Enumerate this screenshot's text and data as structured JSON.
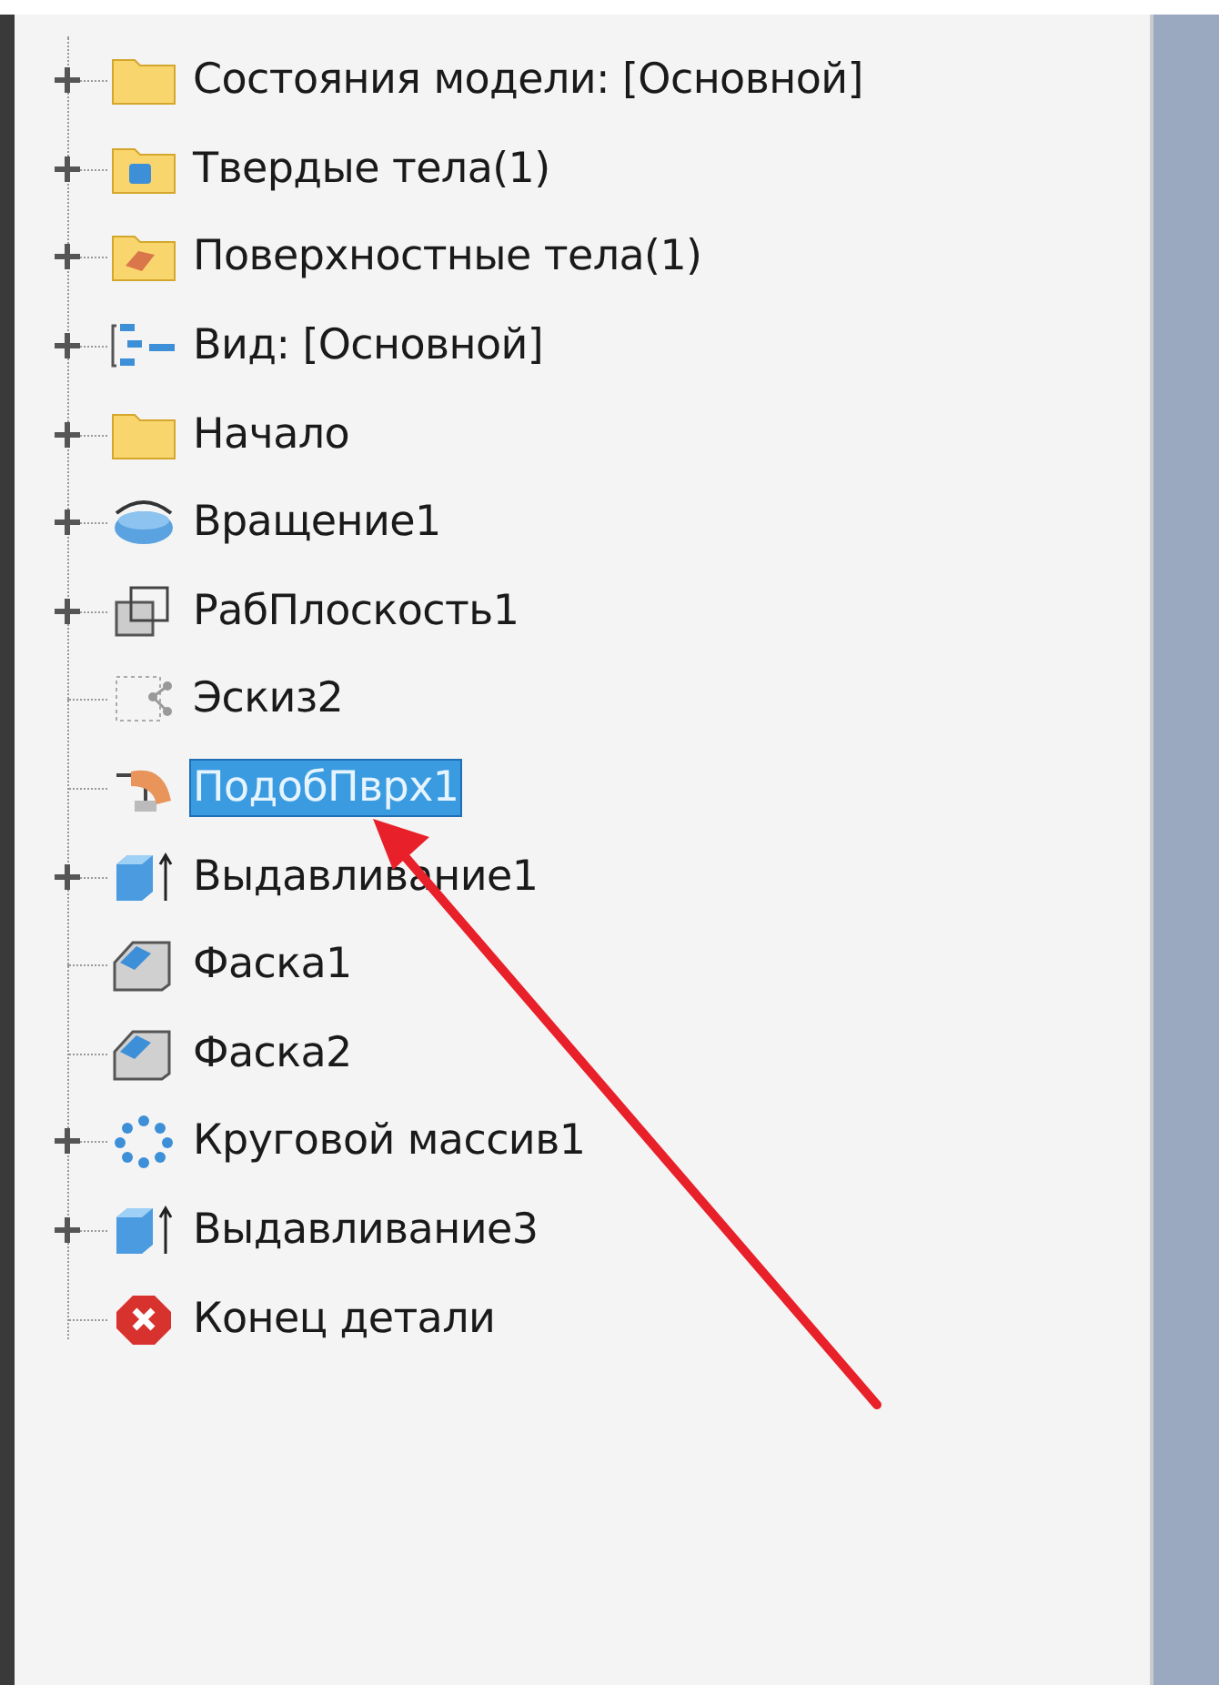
{
  "tree": {
    "items": [
      {
        "label": "Состояния модели: [Основной]",
        "kind": "folder",
        "expandable": true,
        "selected": false
      },
      {
        "label": "Твердые тела(1)",
        "kind": "solid-folder",
        "expandable": true,
        "selected": false
      },
      {
        "label": "Поверхностные тела(1)",
        "kind": "surface-folder",
        "expandable": true,
        "selected": false
      },
      {
        "label": "Вид: [Основной]",
        "kind": "view",
        "expandable": true,
        "selected": false
      },
      {
        "label": "Начало",
        "kind": "folder",
        "expandable": true,
        "selected": false
      },
      {
        "label": "Вращение1",
        "kind": "revolve",
        "expandable": true,
        "selected": false
      },
      {
        "label": "РабПлоскость1",
        "kind": "plane",
        "expandable": true,
        "selected": false
      },
      {
        "label": "Эскиз2",
        "kind": "sketch",
        "expandable": false,
        "selected": false
      },
      {
        "label": "ПодобПврх1",
        "kind": "derived",
        "expandable": false,
        "selected": true
      },
      {
        "label": "Выдавливание1",
        "kind": "extrude",
        "expandable": true,
        "selected": false
      },
      {
        "label": "Фаска1",
        "kind": "chamfer",
        "expandable": false,
        "selected": false
      },
      {
        "label": "Фаска2",
        "kind": "chamfer",
        "expandable": false,
        "selected": false
      },
      {
        "label": "Круговой массив1",
        "kind": "pattern",
        "expandable": true,
        "selected": false
      },
      {
        "label": "Выдавливание3",
        "kind": "extrude",
        "expandable": true,
        "selected": false
      },
      {
        "label": "Конец детали",
        "kind": "end",
        "expandable": false,
        "selected": false
      }
    ]
  }
}
